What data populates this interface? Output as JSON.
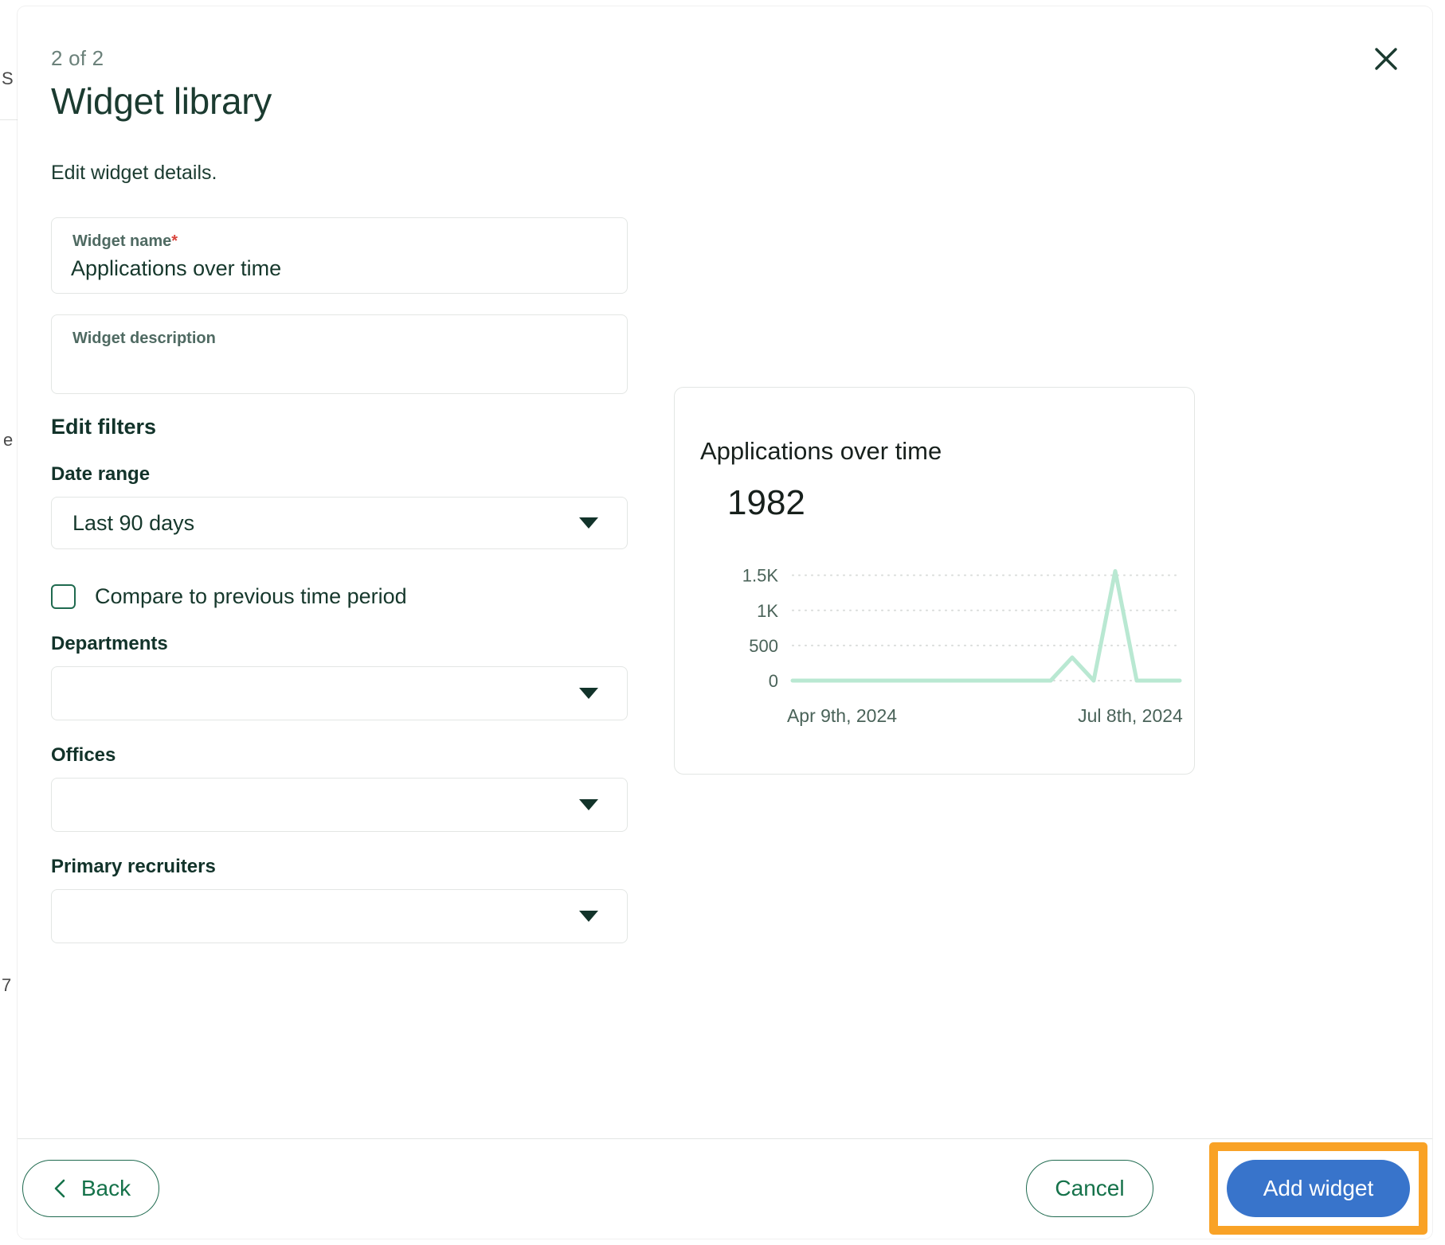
{
  "background": {
    "left_marks": [
      "S",
      "e",
      "7"
    ]
  },
  "modal": {
    "step_counter": "2 of 2",
    "title": "Widget library",
    "subtitle": "Edit widget details.",
    "close_icon": "close-icon"
  },
  "form": {
    "widget_name": {
      "label": "Widget name",
      "required_mark": "*",
      "value": "Applications over time"
    },
    "widget_description": {
      "label": "Widget description",
      "value": ""
    },
    "filters_heading": "Edit filters",
    "date_range": {
      "label": "Date range",
      "value": "Last 90 days"
    },
    "compare_checkbox": {
      "label": "Compare to previous time period",
      "checked": false
    },
    "departments": {
      "label": "Departments",
      "value": ""
    },
    "offices": {
      "label": "Offices",
      "value": ""
    },
    "primary_recruiters": {
      "label": "Primary recruiters",
      "value": ""
    }
  },
  "preview": {
    "title": "Applications over time",
    "metric": "1982"
  },
  "footer": {
    "back_label": "Back",
    "cancel_label": "Cancel",
    "add_widget_label": "Add widget",
    "highlight_color": "#f9a226",
    "primary_button_color": "#3874cb",
    "outline_button_color": "#1f6a4f"
  },
  "chart_data": {
    "type": "line",
    "title": "Applications over time",
    "xlabel": "",
    "ylabel": "",
    "x": [
      "Apr 9th, 2024",
      "Jul 8th, 2024"
    ],
    "x_tick_labels": [
      "Apr 9th, 2024",
      "Jul 8th, 2024"
    ],
    "y_tick_labels": [
      "0",
      "500",
      "1K",
      "1.5K"
    ],
    "y_ticks": [
      0,
      500,
      1000,
      1500
    ],
    "ylim": [
      0,
      1700
    ],
    "grid": true,
    "legend": false,
    "line_color": "#b9e8d2",
    "series": [
      {
        "name": "Applications",
        "values": [
          0,
          0,
          0,
          0,
          0,
          0,
          0,
          0,
          0,
          0,
          0,
          0,
          0,
          330,
          0,
          1560,
          0,
          0,
          0
        ]
      }
    ]
  }
}
